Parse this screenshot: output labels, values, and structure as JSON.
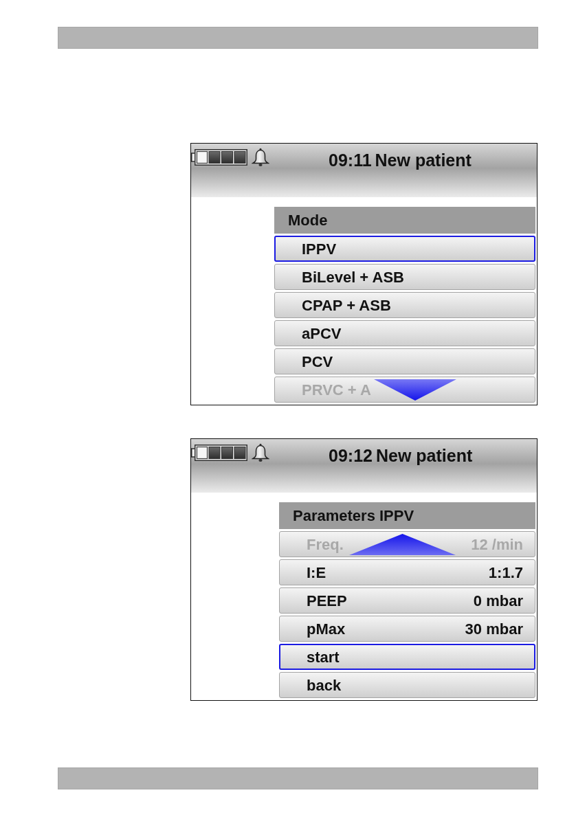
{
  "screens": [
    {
      "time": "09:11",
      "title": "New patient",
      "menu": {
        "title": "Mode",
        "more_above": false,
        "more_below": true,
        "items": [
          {
            "label": "IPPV",
            "selected": true,
            "disabled": false
          },
          {
            "label": "BiLevel + ASB",
            "selected": false,
            "disabled": false
          },
          {
            "label": "CPAP + ASB",
            "selected": false,
            "disabled": false
          },
          {
            "label": "aPCV",
            "selected": false,
            "disabled": false
          },
          {
            "label": "PCV",
            "selected": false,
            "disabled": false
          },
          {
            "label": "PRVC + A",
            "selected": false,
            "disabled": true
          }
        ]
      }
    },
    {
      "time": "09:12",
      "title": "New patient",
      "menu": {
        "title": "Parameters IPPV",
        "more_above": true,
        "more_below": false,
        "items": [
          {
            "label": "Freq.",
            "value": "12 /min",
            "selected": false,
            "disabled": true
          },
          {
            "label": "I:E",
            "value": "1:1.7",
            "selected": false,
            "disabled": false
          },
          {
            "label": "PEEP",
            "value": "0 mbar",
            "selected": false,
            "disabled": false
          },
          {
            "label": "pMax",
            "value": "30 mbar",
            "selected": false,
            "disabled": false
          },
          {
            "label": "start",
            "selected": true,
            "disabled": false
          },
          {
            "label": "back",
            "selected": false,
            "disabled": false
          }
        ]
      }
    }
  ]
}
